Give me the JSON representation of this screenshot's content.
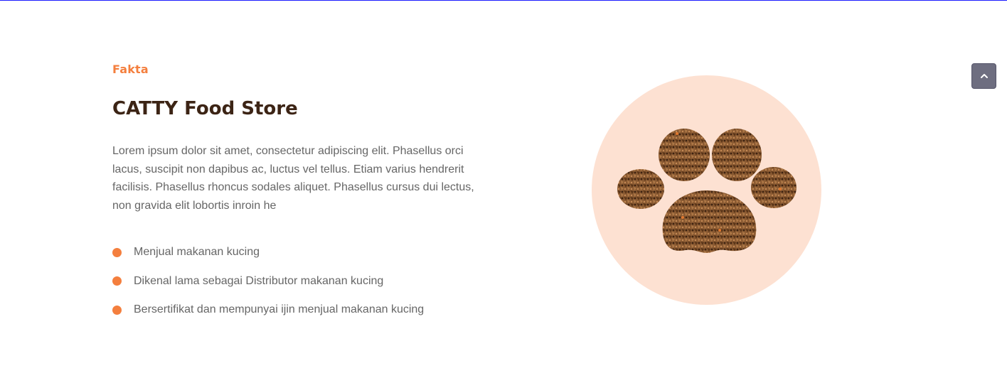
{
  "section": {
    "eyebrow": "Fakta",
    "title": "CATTY Food Store",
    "description": "Lorem ipsum dolor sit amet, consectetur adipiscing elit. Phasellus orci lacus, suscipit non dapibus ac, luctus vel tellus. Etiam varius hendrerit facilisis. Phasellus rhoncus sodales aliquet. Phasellus cursus dui lectus, non gravida elit lobortis inroin he",
    "features": [
      "Menjual makanan kucing",
      "Dikenal lama sebagai Distributor makanan kucing",
      "Bersertifikat dan mempunyai ijin menjual makanan kucing"
    ]
  },
  "image": {
    "icon": "paw-kibble-icon"
  },
  "scroll_top": {
    "icon": "chevron-up-icon"
  },
  "colors": {
    "accent": "#f47f3e",
    "title": "#3c2415",
    "body_text": "#666666",
    "circle_bg": "#fde1d2",
    "kibble": "#8a5a32",
    "scroll_button": "#6e6e80"
  }
}
